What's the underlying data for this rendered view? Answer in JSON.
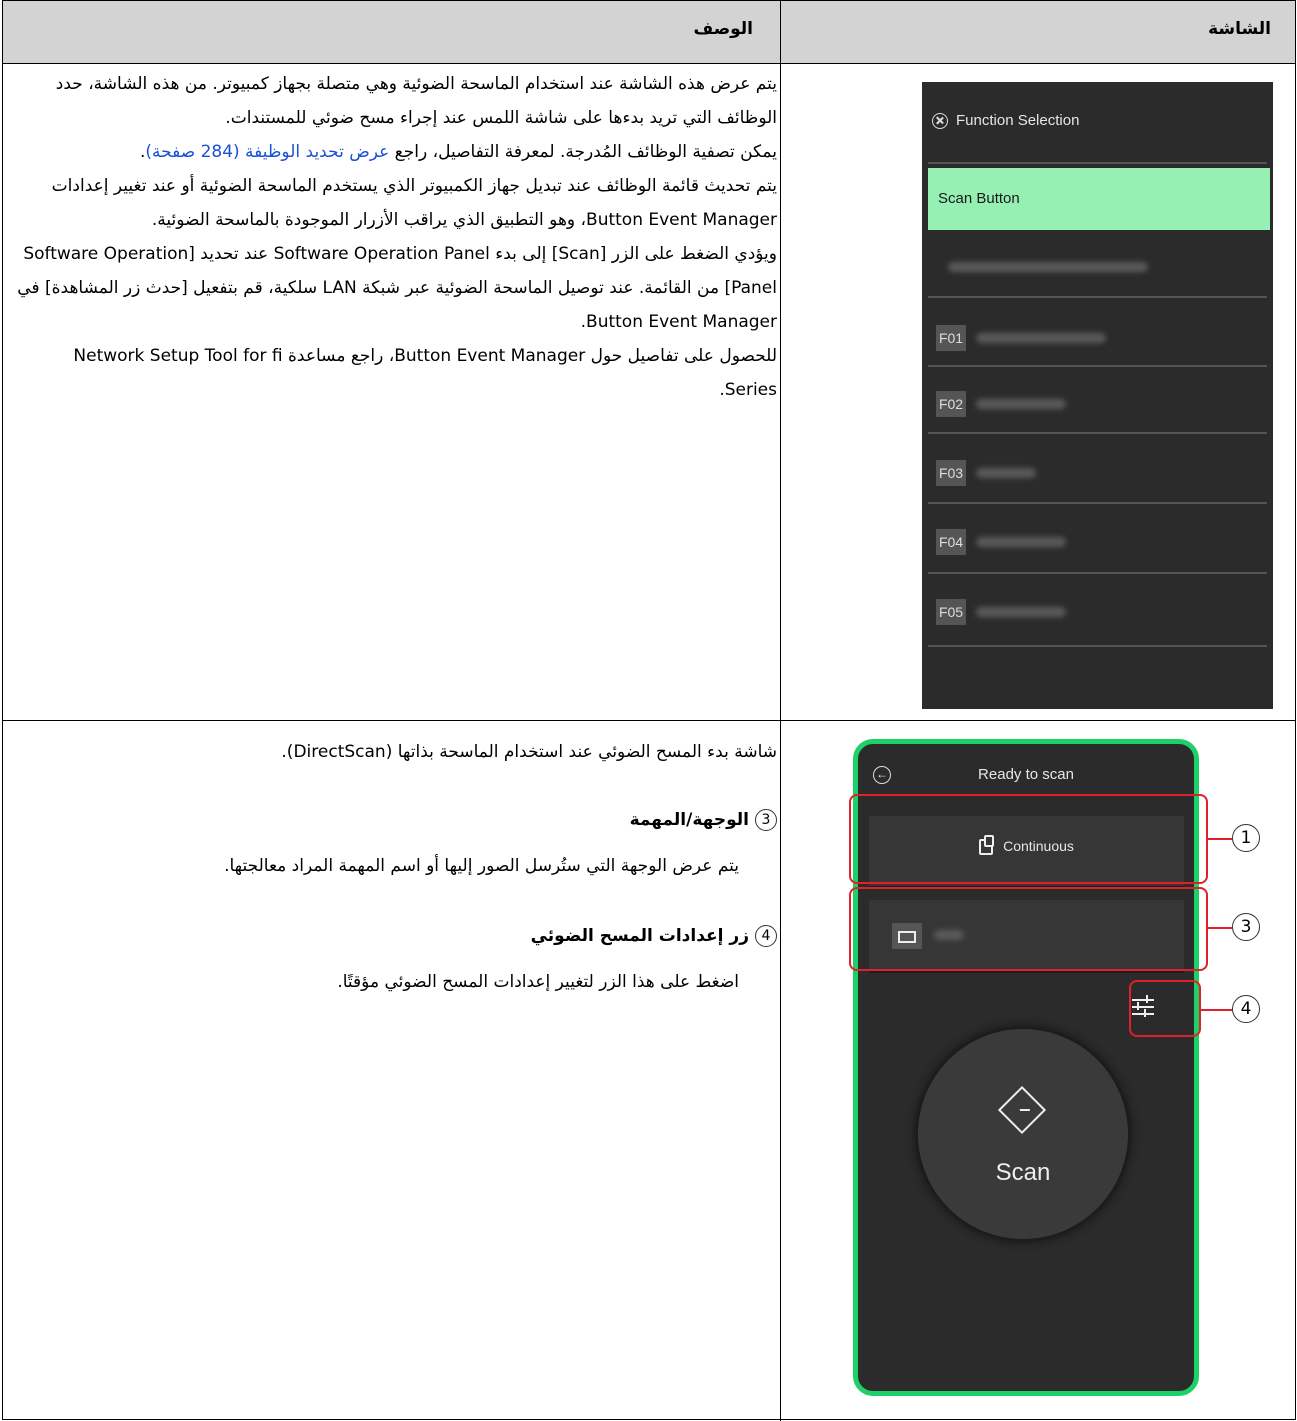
{
  "table": {
    "header_screen": "الشاشة",
    "header_description": "الوصف"
  },
  "row1": {
    "paragraphs": {
      "p1": "يتم عرض هذه الشاشة عند استخدام الماسحة الضوئية وهي متصلة بجهاز كمبيوتر. من هذه الشاشة، حدد الوظائف التي تريد بدءها على شاشة اللمس عند إجراء مسح ضوئي للمستندات.",
      "p2_before": "يمكن تصفية الوظائف المُدرجة. لمعرفة التفاصيل، راجع ",
      "p2_link": "عرض تحديد الوظيفة (284 صفحة)",
      "p2_after": ".",
      "p3": "يتم تحديث قائمة الوظائف عند تبديل جهاز الكمبيوتر الذي يستخدم الماسحة الضوئية أو عند تغيير إعدادات Button Event Manager، وهو التطبيق الذي يراقب الأزرار الموجودة بالماسحة الضوئية.",
      "p4": "ويؤدي الضغط على الزر [Scan] إلى بدء Software Operation Panel عند تحديد [Software Operation Panel] من القائمة. عند توصيل الماسحة الضوئية عبر شبكة LAN سلكية، قم بتفعيل [حدث زر المشاهدة] في Button Event Manager.",
      "p5": "للحصول على تفاصيل حول Button Event Manager، راجع مساعدة Network Setup Tool for fi Series."
    },
    "panel": {
      "title": "Function Selection",
      "selected_item": "Scan Button",
      "function_codes": [
        "F01",
        "F02",
        "F03",
        "F04",
        "F05"
      ],
      "selected_color": "#96f0b4"
    }
  },
  "row2": {
    "intro": "شاشة بدء المسح الضوئي عند استخدام الماسحة بذاتها (DirectScan).",
    "sections": {
      "s3": {
        "number": "3",
        "heading": "الوجهة/المهمة",
        "text": "يتم عرض الوجهة التي ستُرسل الصور إليها أو اسم المهمة المراد معالجتها."
      },
      "s4": {
        "number": "4",
        "heading": "زر إعدادات المسح الضوئي",
        "text": "اضغط على هذا الزر لتغيير إعدادات المسح الضوئي مؤقتًا."
      }
    },
    "panel": {
      "title": "Ready to scan",
      "mode_button": "Continuous",
      "scan_label": "Scan",
      "callouts": [
        "1",
        "3",
        "4"
      ],
      "frame_color": "#1ed068",
      "highlight_color": "#e0202a"
    }
  }
}
